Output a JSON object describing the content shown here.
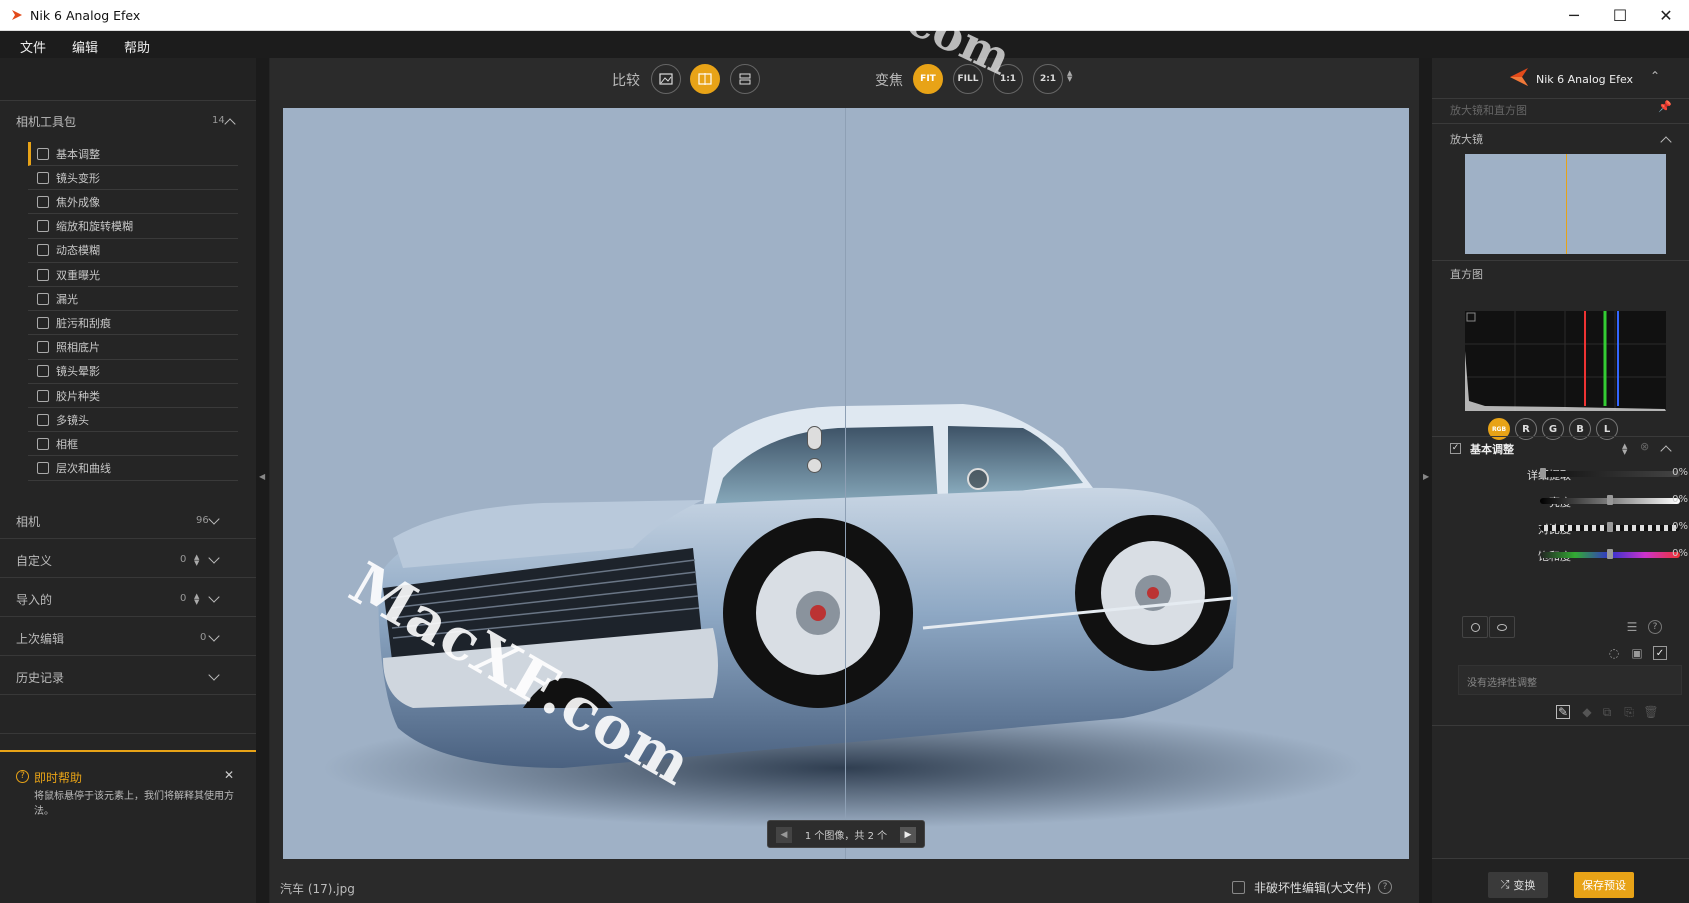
{
  "window": {
    "title": "Nik 6 Analog Efex",
    "minimize": "─",
    "maximize": "☐",
    "close": "✕"
  },
  "menu": [
    "文件",
    "编辑",
    "帮助"
  ],
  "left_panel": {
    "toolkit": {
      "label": "相机工具包",
      "count": "14"
    },
    "tools": [
      {
        "label": "基本调整",
        "active": true
      },
      {
        "label": "镜头变形"
      },
      {
        "label": "焦外成像"
      },
      {
        "label": "缩放和旋转模糊"
      },
      {
        "label": "动态模糊"
      },
      {
        "label": "双重曝光"
      },
      {
        "label": "漏光"
      },
      {
        "label": "脏污和刮痕"
      },
      {
        "label": "照相底片"
      },
      {
        "label": "镜头晕影"
      },
      {
        "label": "胶片种类"
      },
      {
        "label": "多镜头"
      },
      {
        "label": "相框"
      },
      {
        "label": "层次和曲线"
      }
    ],
    "sections": [
      {
        "label": "相机",
        "count": "96"
      },
      {
        "label": "自定义",
        "count": "0"
      },
      {
        "label": "导入的",
        "count": "0"
      },
      {
        "label": "上次编辑",
        "count": "0"
      },
      {
        "label": "历史记录",
        "count": ""
      }
    ],
    "help": {
      "title": "即时帮助",
      "text": "将鼠标悬停于该元素上，我们将解释其使用方法。",
      "close": "✕"
    }
  },
  "toolbar": {
    "compare_label": "比较",
    "zoom_label": "变焦",
    "zoom_buttons": [
      "FIT",
      "FILL",
      "1:1",
      "2:1"
    ],
    "zoom_active": "FIT"
  },
  "image": {
    "pager_text": "1 个图像，共 2 个",
    "prev": "◀",
    "next": "▶"
  },
  "status": {
    "filename": "汽车 (17).jpg",
    "nondestructive_label": "非破坏性编辑(大文件)",
    "help_icon": "?"
  },
  "right_panel": {
    "app_name": "Nik 6 Analog Efex",
    "section_label": "放大镜和直方图",
    "loupe_label": "放大镜",
    "histogram_label": "直方图",
    "hist_buttons": [
      "RGB",
      "R",
      "G",
      "B",
      "L"
    ],
    "hist_active": "RGB",
    "basic_adjust": {
      "title": "基本调整",
      "sliders": [
        {
          "label": "详细提取",
          "value": "0%",
          "knob": 0.0
        },
        {
          "label": "亮度",
          "value": "0%",
          "knob": 0.5
        },
        {
          "label": "对比度",
          "value": "0%",
          "knob": 0.5
        },
        {
          "label": "饱和度",
          "value": "0%",
          "knob": 0.5
        }
      ],
      "no_selective": "没有选择性调整"
    },
    "buttons": {
      "random": "变换",
      "save_preset": "保存预设"
    }
  },
  "watermark": {
    "text": "MacXF.com"
  },
  "colors": {
    "accent": "#e8a317",
    "canvas_bg": "#9fb1c6",
    "panel": "#252525"
  }
}
